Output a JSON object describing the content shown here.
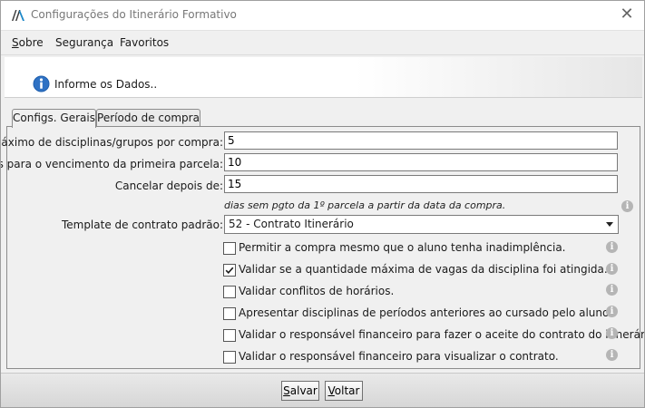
{
  "window": {
    "title": "Configurações do Itinerário Formativo",
    "close_glyph": "✕"
  },
  "menu": [
    {
      "accel": "S",
      "rest": "obre"
    },
    {
      "accel": "",
      "rest": "Segurança"
    },
    {
      "accel": "",
      "rest": "Favoritos"
    }
  ],
  "banner": {
    "text": "Informe os Dados.."
  },
  "tabs": {
    "general": "Configs. Gerais",
    "period": "Período de compra"
  },
  "form": {
    "max_label": "Máximo de disciplinas/grupos por compra:",
    "max_value": "5",
    "due_label": "Dias para o vencimento da primeira parcela:",
    "due_value": "10",
    "cancel_label": "Cancelar depois de:",
    "cancel_value": "15",
    "cancel_hint": "dias sem pgto da 1º parcela a partir da data da compra.",
    "template_label": "Template de contrato padrão:",
    "template_value": "52 - Contrato Itinerário"
  },
  "options": [
    {
      "label": "Permitir a compra mesmo que o aluno tenha inadimplência.",
      "checked": false
    },
    {
      "label": "Validar se a quantidade máxima de vagas da disciplina foi atingida.",
      "checked": true
    },
    {
      "label": "Validar conflitos de horários.",
      "checked": false
    },
    {
      "label": "Apresentar disciplinas de períodos anteriores ao cursado pelo aluno.",
      "checked": false
    },
    {
      "label": "Validar o responsável financeiro para fazer o aceite do contrato do itinerário.",
      "checked": false
    },
    {
      "label": "Validar o responsável financeiro para visualizar o contrato.",
      "checked": false
    }
  ],
  "info_glyph": "i",
  "buttons": {
    "save": {
      "accel": "S",
      "rest": "alvar"
    },
    "back": {
      "accel": "V",
      "rest": "oltar"
    }
  },
  "colors": {
    "check": "#1a1a1a",
    "info_icon": "#1f5fae",
    "help_icon": "#b5b5b5"
  }
}
